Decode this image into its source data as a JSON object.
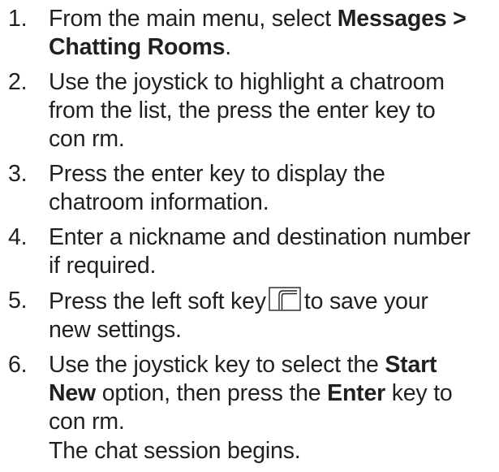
{
  "steps": [
    {
      "number": "1.",
      "lines": [
        {
          "pre": "From the main menu, select ",
          "bold": "Messages >"
        },
        {
          "bold": "Chatting Rooms",
          "post": "."
        }
      ]
    },
    {
      "number": "2.",
      "lines": [
        "Use the joystick to highlight a chatroom",
        "from the list, the press the enter key to",
        "con  rm."
      ]
    },
    {
      "number": "3.",
      "lines": [
        "Press the enter key to display the",
        "chatroom information."
      ]
    },
    {
      "number": "4.",
      "lines": [
        "Enter a nickname and destination number",
        "if required."
      ]
    },
    {
      "number": "5.",
      "line1_pre": "Press the left soft key",
      "line1_post": "to save your",
      "line2": "new settings.",
      "softkey_icon": "left-soft-key-icon"
    },
    {
      "number": "6.",
      "line1_pre": "Use the joystick key to select the ",
      "line1_bold": "Start",
      "line2_bold": "New",
      "line2_mid": " option, then press the ",
      "line2_bold2": "Enter",
      "line2_post": " key to",
      "line3": "con  rm.",
      "result": "The chat session begins."
    }
  ],
  "colors": {
    "text": "#231f20",
    "background": "#ffffff"
  }
}
